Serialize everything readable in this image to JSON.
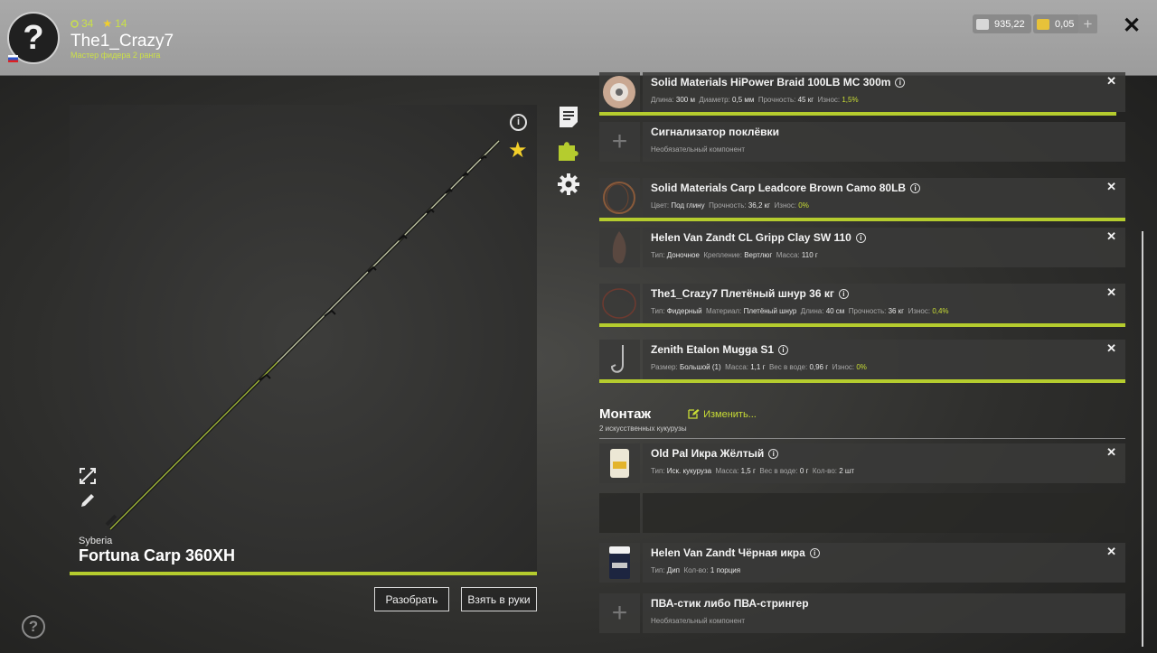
{
  "player": {
    "avatar": "?",
    "level": "34",
    "rank_level": "14",
    "name": "The1_Crazy7",
    "rank_title": "Мастер фидера 2 ранга"
  },
  "currency": {
    "silver": "935,22",
    "gold": "0,05"
  },
  "rod": {
    "brand": "Syberia",
    "name": "Fortuna Carp 360XH",
    "disassemble_label": "Разобрать",
    "take_label": "Взять в руки"
  },
  "components": [
    {
      "title": "Solid Materials HiPower Braid 100LB MC 300m",
      "props": [
        {
          "k": "Длина:",
          "v": "300 м"
        },
        {
          "k": "Диаметр:",
          "v": "0,5 мм"
        },
        {
          "k": "Прочность:",
          "v": "45 кг"
        },
        {
          "k": "Износ:",
          "v": "1,5%",
          "green": true
        }
      ],
      "wear_fill": 0.98
    },
    {
      "title": "Сигнализатор поклёвки",
      "note": "Необязательный компонент"
    },
    {
      "title": "Solid Materials Carp Leadcore Brown Camo 80LB",
      "props": [
        {
          "k": "Цвет:",
          "v": "Под глину"
        },
        {
          "k": "Прочность:",
          "v": "36,2 кг"
        },
        {
          "k": "Износ:",
          "v": "0%",
          "green": true
        }
      ],
      "wear_fill": 1.0
    },
    {
      "title": "Helen Van Zandt CL Gripp Clay SW 110",
      "props": [
        {
          "k": "Тип:",
          "v": "Доночное"
        },
        {
          "k": "Крепление:",
          "v": "Вертлюг"
        },
        {
          "k": "Масса:",
          "v": "110 г"
        }
      ]
    },
    {
      "title": "The1_Crazy7 Плетёный шнур 36 кг",
      "props": [
        {
          "k": "Тип:",
          "v": "Фидерный"
        },
        {
          "k": "Материал:",
          "v": "Плетёный шнур"
        },
        {
          "k": "Длина:",
          "v": "40 см"
        },
        {
          "k": "Прочность:",
          "v": "36 кг"
        },
        {
          "k": "Износ:",
          "v": "0,4%",
          "green": true
        }
      ],
      "wear_fill": 1.0
    },
    {
      "title": "Zenith Etalon Mugga S1",
      "props": [
        {
          "k": "Размер:",
          "v": "Большой (1)"
        },
        {
          "k": "Масса:",
          "v": "1,1 г"
        },
        {
          "k": "Вес в воде:",
          "v": "0,96 г"
        },
        {
          "k": "Износ:",
          "v": "0%",
          "green": true
        }
      ],
      "wear_fill": 1.0
    }
  ],
  "rig": {
    "heading": "Монтаж",
    "change_label": "Изменить...",
    "description": "2 искусственных кукурузы",
    "items": [
      {
        "title": "Old Pal Икра Жёлтый",
        "props": [
          {
            "k": "Тип:",
            "v": "Иск. кукуруза"
          },
          {
            "k": "Масса:",
            "v": "1,5 г"
          },
          {
            "k": "Вес в воде:",
            "v": "0 г"
          },
          {
            "k": "Кол-во:",
            "v": "2 шт"
          }
        ]
      },
      {
        "empty": true
      },
      {
        "title": "Helen Van Zandt Чёрная икра",
        "props": [
          {
            "k": "Тип:",
            "v": "Дип"
          },
          {
            "k": "Кол-во:",
            "v": "1 порция"
          }
        ]
      },
      {
        "title": "ПВА-стик либо ПВА-стрингер",
        "note": "Необязательный компонент"
      }
    ]
  },
  "icons": {
    "info": "info-icon",
    "favorite": "star-icon",
    "notes": "notes-icon",
    "parts": "puzzle-icon",
    "settings": "gear-icon",
    "expand": "expand-icon",
    "edit": "pencil-icon",
    "help": "help-icon",
    "close": "close-icon"
  },
  "colors": {
    "accent": "#b5cc2e",
    "star": "#f2cf2a"
  }
}
